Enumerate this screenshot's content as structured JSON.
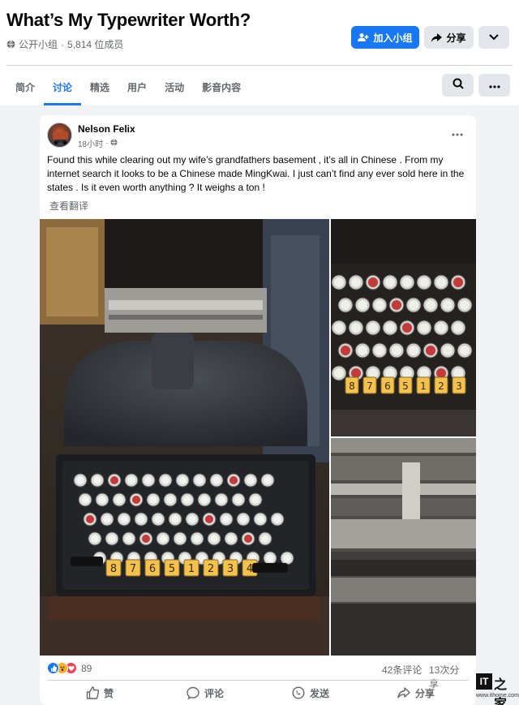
{
  "group": {
    "title": "What’s My Typewriter Worth?",
    "privacy": "公开小组",
    "separator": "·",
    "members": "5,814 位成员",
    "join_label": "加入小组",
    "share_label": "分享"
  },
  "tabs": [
    {
      "label": "简介",
      "active": false
    },
    {
      "label": "讨论",
      "active": true
    },
    {
      "label": "精选",
      "active": false
    },
    {
      "label": "用户",
      "active": false
    },
    {
      "label": "活动",
      "active": false
    },
    {
      "label": "影音内容",
      "active": false
    }
  ],
  "post": {
    "author": "Nelson Felix",
    "time": "18小时",
    "time_separator": "·",
    "text": "Found this while clearing out my wife’s grandfathers basement , it’s all in Chinese . From my internet search it looks to be a Chinese made MingKwai. I just can’t find any ever sold here in the states . Is it even worth anything ? It weighs a ton !",
    "translate_label": "查看翻译",
    "reaction_count": "89",
    "comment_count": "42条评论",
    "share_count": "13次分享",
    "number_keys": [
      "8",
      "7",
      "6",
      "5",
      "1",
      "2",
      "3",
      "4"
    ]
  },
  "actions": {
    "like": "赞",
    "comment": "评论",
    "send": "发送",
    "share": "分享"
  },
  "watermark": {
    "logo": "IT",
    "glyph": "之家",
    "site": "www.ithome.com"
  },
  "colors": {
    "accent": "#1877f2",
    "secondary_text": "#65676b",
    "button_grey": "#e4e6eb",
    "page_bg": "#f0f2f5"
  },
  "icons": [
    "globe-icon",
    "group-join-icon",
    "share-arrow-icon",
    "chevron-down-icon",
    "search-icon",
    "more-icon",
    "like-icon",
    "comment-icon",
    "send-icon",
    "share-icon"
  ]
}
